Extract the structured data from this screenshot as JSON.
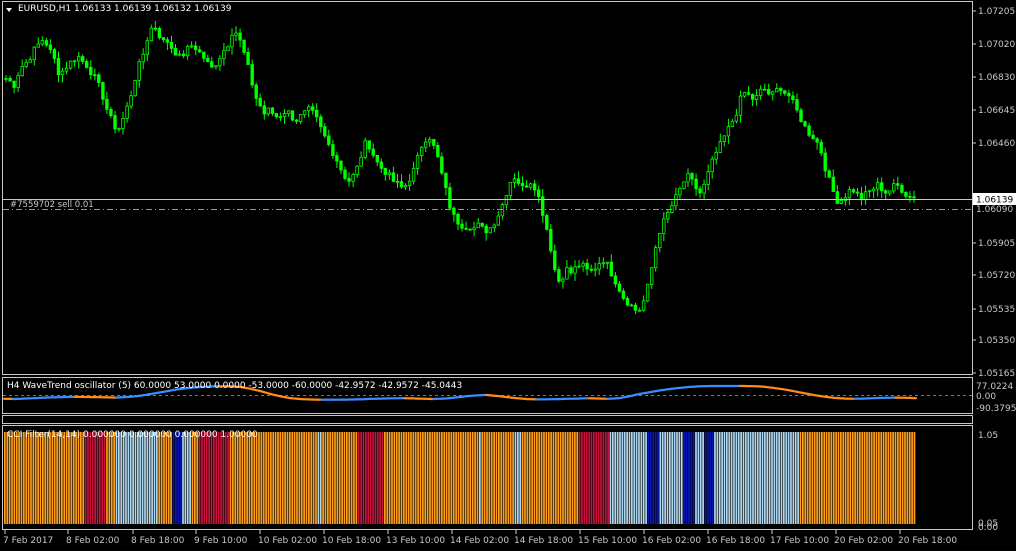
{
  "main_title": "EURUSD,H1  1.06133 1.06139 1.06132 1.06139",
  "menu_icon": "triangle-down-icon",
  "order_label": "#7559702 sell 0.01",
  "current_price_label": "1.06139",
  "order_price_label": "1.06090",
  "price_axis": [
    "1.07205",
    "1.07020",
    "1.06830",
    "1.06645",
    "1.06460",
    "1.05905",
    "1.05720",
    "1.05535",
    "1.05350",
    "1.05165"
  ],
  "osc_title": "H4 WaveTrend oscillator (5) 60.0000 53.0000 0.0000 -53.0000 -60.0000 -42.9572 -42.9572 -45.0443",
  "osc_axis": [
    "77.0224",
    "0.00",
    "-90.3795"
  ],
  "cci_title": "CCI Filter(14,14) 0.000000 0.000000 0.000000 1.00000",
  "cci_axis": [
    "1.05",
    "0.05",
    "0.00"
  ],
  "time_axis": [
    "7 Feb 2017",
    "8 Feb 02:00",
    "8 Feb 18:00",
    "9 Feb 10:00",
    "10 Feb 02:00",
    "10 Feb 18:00",
    "13 Feb 10:00",
    "14 Feb 02:00",
    "14 Feb 18:00",
    "15 Feb 10:00",
    "16 Feb 02:00",
    "16 Feb 18:00",
    "17 Feb 10:00",
    "20 Feb 02:00",
    "20 Feb 18:00"
  ],
  "colors": {
    "background": "#000000",
    "frame": "#c8c8c8",
    "candle": "#00ff00",
    "order_line": "#00ff00",
    "current_price_bg": "#ffffff",
    "wave_up": "#3a8dff",
    "wave_down": "#ff8c1a",
    "cci_orange": "#ff9f1a",
    "cci_red": "#c8143c",
    "cci_lightblue": "#b0d8f0",
    "cci_blue": "#0a16b4"
  },
  "price_path": [
    1.068,
    1.0678,
    1.0676,
    1.0685,
    1.0688,
    1.069,
    1.0695,
    1.0698,
    1.0702,
    1.07,
    1.0695,
    1.069,
    1.0682,
    1.0685,
    1.0688,
    1.069,
    1.0693,
    1.069,
    1.0688,
    1.0684,
    1.068,
    1.0675,
    1.0668,
    1.066,
    1.0655,
    1.065,
    1.0655,
    1.0662,
    1.067,
    1.068,
    1.0688,
    1.0695,
    1.0705,
    1.071,
    1.0708,
    1.07,
    1.0702,
    1.0698,
    1.0695,
    1.0692,
    1.0694,
    1.0697,
    1.0699,
    1.0696,
    1.0693,
    1.069,
    1.0685,
    1.0688,
    1.0692,
    1.0696,
    1.07,
    1.0708,
    1.0705,
    1.0698,
    1.069,
    1.068,
    1.067,
    1.0665,
    1.066,
    1.0662,
    1.066,
    1.0658,
    1.066,
    1.0662,
    1.0659,
    1.0656,
    1.0658,
    1.066,
    1.0662,
    1.066,
    1.0656,
    1.065,
    1.0645,
    1.064,
    1.0636,
    1.063,
    1.0625,
    1.0622,
    1.0625,
    1.063,
    1.0638,
    1.0645,
    1.064,
    1.0634,
    1.063,
    1.0628,
    1.0625,
    1.0622,
    1.062,
    1.0618,
    1.062,
    1.0625,
    1.063,
    1.064,
    1.0645,
    1.0648,
    1.0642,
    1.0635,
    1.0625,
    1.0615,
    1.0605,
    1.06,
    1.0598,
    1.0596,
    1.0597,
    1.0595,
    1.0597,
    1.0595,
    1.0594,
    1.0596,
    1.06,
    1.0605,
    1.0612,
    1.062,
    1.0625,
    1.0622,
    1.0618,
    1.062,
    1.0622,
    1.0618,
    1.061,
    1.06,
    1.059,
    1.0575,
    1.0565,
    1.0568,
    1.0572,
    1.057,
    1.0573,
    1.0575,
    1.0573,
    1.057,
    1.0572,
    1.0575,
    1.0578,
    1.0575,
    1.057,
    1.0565,
    1.056,
    1.0555,
    1.0553,
    1.055,
    1.0548,
    1.0552,
    1.056,
    1.0572,
    1.0585,
    1.0595,
    1.06,
    1.0605,
    1.061,
    1.0615,
    1.062,
    1.0625,
    1.0622,
    1.0618,
    1.0615,
    1.062,
    1.0628,
    1.0635,
    1.064,
    1.0645,
    1.065,
    1.0655,
    1.066,
    1.0668,
    1.0672,
    1.067,
    1.0668,
    1.067,
    1.0675,
    1.0672,
    1.067,
    1.0673,
    1.0675,
    1.0672,
    1.067,
    1.0665,
    1.066,
    1.0655,
    1.065,
    1.0648,
    1.0645,
    1.064,
    1.063,
    1.0622,
    1.0615,
    1.061,
    1.0612,
    1.0615,
    1.0618,
    1.0615,
    1.0612,
    1.0614,
    1.0616,
    1.0618,
    1.062,
    1.0617,
    1.0615,
    1.0618,
    1.062,
    1.0618,
    1.0615,
    1.0613,
    1.0614
  ],
  "osc_path": [
    -30,
    -32,
    -28,
    -25,
    -20,
    -18,
    -15,
    -14,
    -15,
    -16,
    -18,
    -20,
    -15,
    -8,
    5,
    20,
    35,
    50,
    60,
    68,
    72,
    75,
    74,
    70,
    55,
    35,
    10,
    -10,
    -25,
    -33,
    -36,
    -38,
    -38,
    -37,
    -36,
    -34,
    -30,
    -28,
    -26,
    -25,
    -27,
    -30,
    -32,
    -28,
    -20,
    -10,
    -2,
    2,
    -5,
    -15,
    -25,
    -32,
    -35,
    -34,
    -33,
    -30,
    -28,
    -26,
    -28,
    -30,
    -25,
    -10,
    10,
    25,
    40,
    52,
    62,
    70,
    75,
    77,
    77,
    77,
    77,
    76,
    72,
    62,
    50,
    35,
    18,
    2,
    -12,
    -22,
    -28,
    -30,
    -28,
    -24,
    -22,
    -20,
    -22,
    -25
  ],
  "cci_bars": "OOOOOOOOOOOOOOOOOOOOOOOOOOOOOOOOOORRRRRRRRROOOOLLLLLLLLLLLLLLLLLLOOOOOOBBBBLLLLOOORRRRRRRRRRRRROOOOOOOOOOOOOOOOOOOOOOOOOOOOOOOOOOOOOLLOOOOOOOOOOOOOOORRRRRRRRRRROOOOOOOOOOOOOOOOOOOOOOOOOOOOOOOOOOOOOOOOLOOOOOOOOOOOOOOLLLOOOOOOOOOOOOOOOOOOOOOOOORRRRRRRRRRRRRLLLLLLLLLLLLLLLLBBBBBLLLLLLLLLLBBBBBLLLLBBBBLLLLLLLLLLLLLLLLLLLLLLLLLLLLLLLLLLLLOOOOOOOOOOOOOOOOOOOOOOOOOOOOOOOOOOOOOOOOOOOOOOOOO"
}
